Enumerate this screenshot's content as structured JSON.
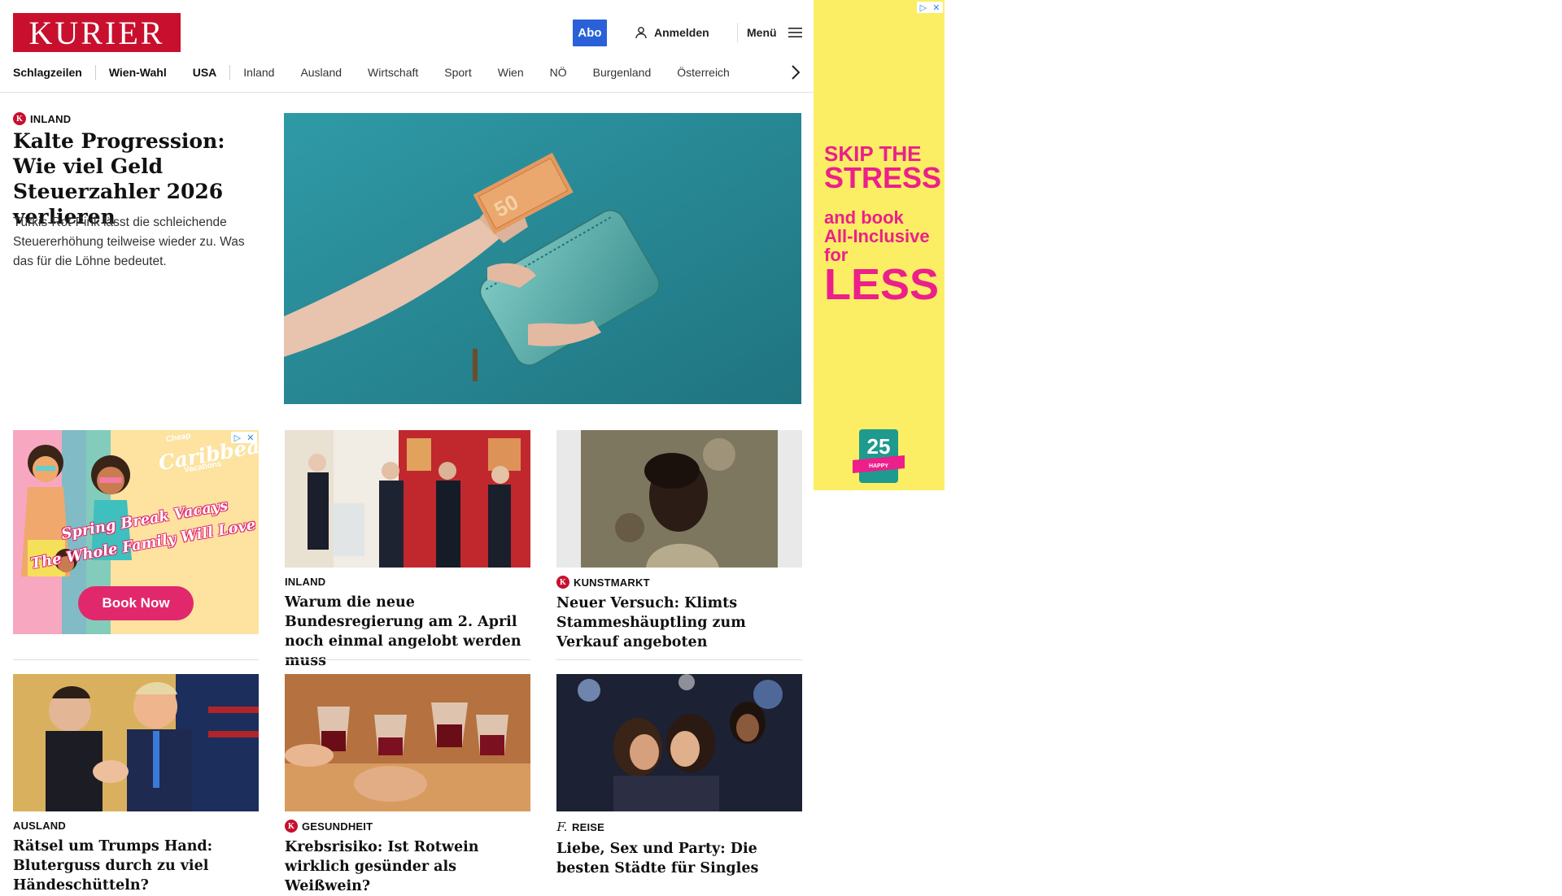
{
  "header": {
    "logo": "KURIER",
    "abo_label": "Abo",
    "login_label": "Anmelden",
    "menu_label": "Menü"
  },
  "nav": {
    "items": [
      "Schlagzeilen",
      "Wien-Wahl",
      "USA",
      "Inland",
      "Ausland",
      "Wirtschaft",
      "Sport",
      "Wien",
      "NÖ",
      "Burgenland",
      "Österreich"
    ]
  },
  "hero": {
    "category": "INLAND",
    "title": "Kalte Progression: Wie viel Geld Steuerzahler 2026 verlieren",
    "teaser": "Türkis-Rot-Pink lässt die schleichende Steuererhöhung teilweise wieder zu. Was das für die Löhne bedeutet.",
    "image_alt": "Hand steckt 50-Euro-Schein in Geldbörse"
  },
  "ads": {
    "right": {
      "line1": "SKIP THE",
      "line2": "STRESS",
      "line3": "and book",
      "line4": "All-Inclusive",
      "line5": "for",
      "line6": "LESS",
      "badge_number": "25",
      "badge_text": "YEARS OF HAPPY CUSTOMERS"
    },
    "left": {
      "brand_top": "Cheap",
      "brand": "Caribbean",
      "brand_bottom": "Vacations",
      "headline1": "Spring Break Vacays",
      "headline2": "The Whole Family Will Love",
      "button": "Book Now"
    }
  },
  "cards": [
    {
      "category": "INLAND",
      "title": "Warum die neue Bundesregierung am 2. April noch einmal angelobt werden muss",
      "has_logo": false
    },
    {
      "category": "KUNSTMARKT",
      "title": "Neuer Versuch: Klimts Stammeshäuptling zum Verkauf angeboten",
      "has_logo": true
    },
    {
      "category": "AUSLAND",
      "title": "Rätsel um Trumps Hand: Bluterguss durch zu viel Händeschütteln?",
      "has_logo": false
    },
    {
      "category": "GESUNDHEIT",
      "title": "Krebsrisiko: Ist Rotwein wirklich gesünder als Weißwein?",
      "has_logo": true
    },
    {
      "category": "REISE",
      "title": "Liebe, Sex und Party: Die besten Städte für Singles",
      "has_logo": false
    }
  ],
  "colors": {
    "brand_red": "#c8102e",
    "abo_blue": "#2a61d8",
    "ad_yellow": "#fbee64",
    "ad_pink": "#ec1f8b"
  }
}
